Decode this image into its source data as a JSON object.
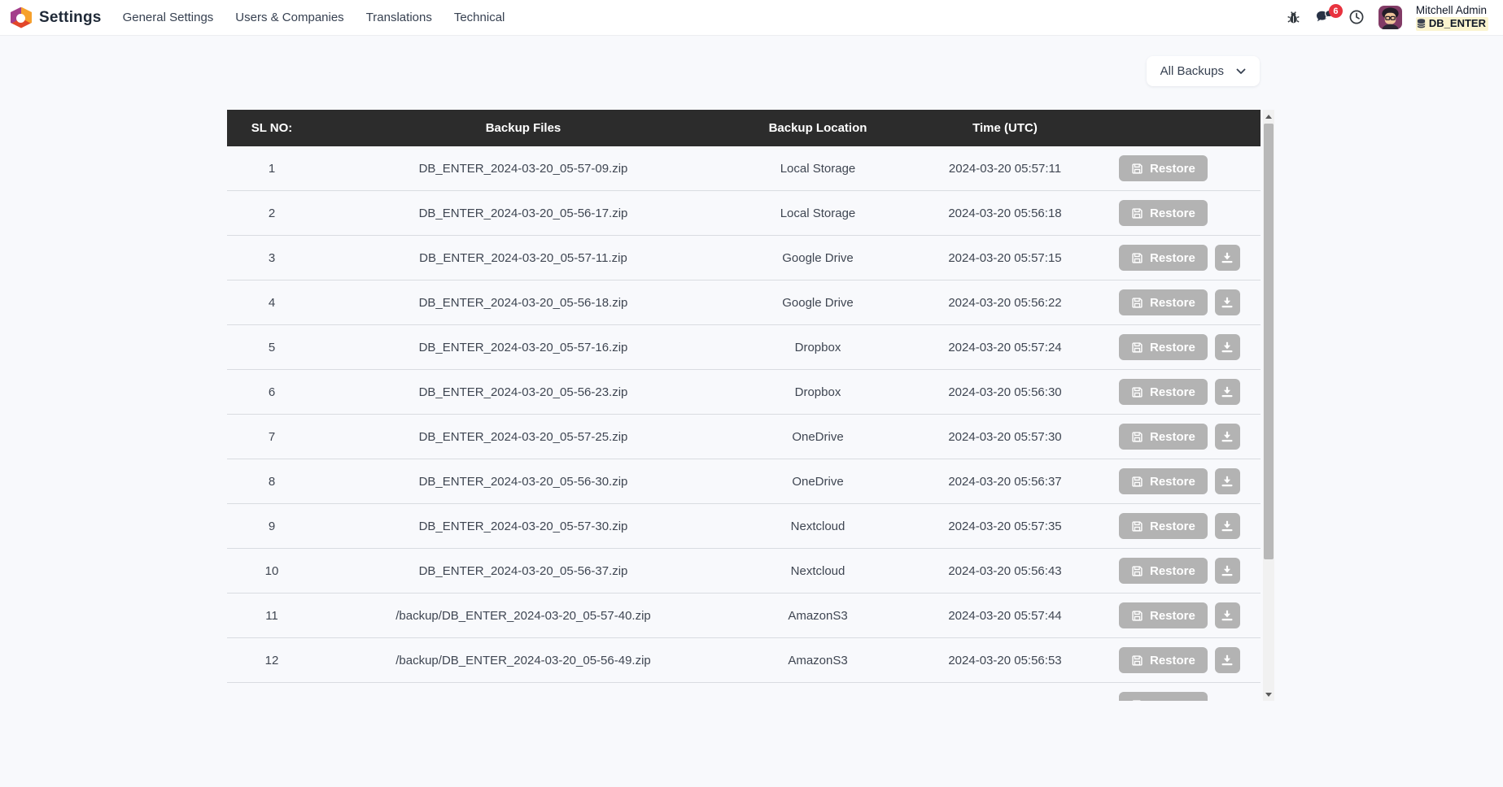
{
  "navbar": {
    "app_name": "Settings",
    "menu_items": [
      "General Settings",
      "Users & Companies",
      "Translations",
      "Technical"
    ],
    "message_badge": "6",
    "user": {
      "name": "Mitchell Admin",
      "database": "DB_ENTER"
    }
  },
  "filter": {
    "label": "All Backups"
  },
  "table": {
    "headers": [
      "SL NO:",
      "Backup Files",
      "Backup Location",
      "Time (UTC)"
    ],
    "restore_label": "Restore",
    "rows": [
      {
        "sl": "1",
        "file": "DB_ENTER_2024-03-20_05-57-09.zip",
        "location": "Local Storage",
        "time": "2024-03-20 05:57:11",
        "has_download": false
      },
      {
        "sl": "2",
        "file": "DB_ENTER_2024-03-20_05-56-17.zip",
        "location": "Local Storage",
        "time": "2024-03-20 05:56:18",
        "has_download": false
      },
      {
        "sl": "3",
        "file": "DB_ENTER_2024-03-20_05-57-11.zip",
        "location": "Google Drive",
        "time": "2024-03-20 05:57:15",
        "has_download": true
      },
      {
        "sl": "4",
        "file": "DB_ENTER_2024-03-20_05-56-18.zip",
        "location": "Google Drive",
        "time": "2024-03-20 05:56:22",
        "has_download": true
      },
      {
        "sl": "5",
        "file": "DB_ENTER_2024-03-20_05-57-16.zip",
        "location": "Dropbox",
        "time": "2024-03-20 05:57:24",
        "has_download": true
      },
      {
        "sl": "6",
        "file": "DB_ENTER_2024-03-20_05-56-23.zip",
        "location": "Dropbox",
        "time": "2024-03-20 05:56:30",
        "has_download": true
      },
      {
        "sl": "7",
        "file": "DB_ENTER_2024-03-20_05-57-25.zip",
        "location": "OneDrive",
        "time": "2024-03-20 05:57:30",
        "has_download": true
      },
      {
        "sl": "8",
        "file": "DB_ENTER_2024-03-20_05-56-30.zip",
        "location": "OneDrive",
        "time": "2024-03-20 05:56:37",
        "has_download": true
      },
      {
        "sl": "9",
        "file": "DB_ENTER_2024-03-20_05-57-30.zip",
        "location": "Nextcloud",
        "time": "2024-03-20 05:57:35",
        "has_download": true
      },
      {
        "sl": "10",
        "file": "DB_ENTER_2024-03-20_05-56-37.zip",
        "location": "Nextcloud",
        "time": "2024-03-20 05:56:43",
        "has_download": true
      },
      {
        "sl": "11",
        "file": "/backup/DB_ENTER_2024-03-20_05-57-40.zip",
        "location": "AmazonS3",
        "time": "2024-03-20 05:57:44",
        "has_download": true
      },
      {
        "sl": "12",
        "file": "/backup/DB_ENTER_2024-03-20_05-56-49.zip",
        "location": "AmazonS3",
        "time": "2024-03-20 05:56:53",
        "has_download": true
      },
      {
        "sl": "",
        "file": "",
        "location": "",
        "time": "",
        "has_download": false,
        "partial": true
      }
    ]
  },
  "colors": {
    "header_bg": "#2c2c2c",
    "button_bg": "#b3b3b3",
    "badge_bg": "#e8323e",
    "db_highlight": "#fbf4cf",
    "page_bg": "#f8f9fc",
    "accent_logo": [
      "#a43e8b",
      "#f6a02c",
      "#e2472a"
    ]
  }
}
